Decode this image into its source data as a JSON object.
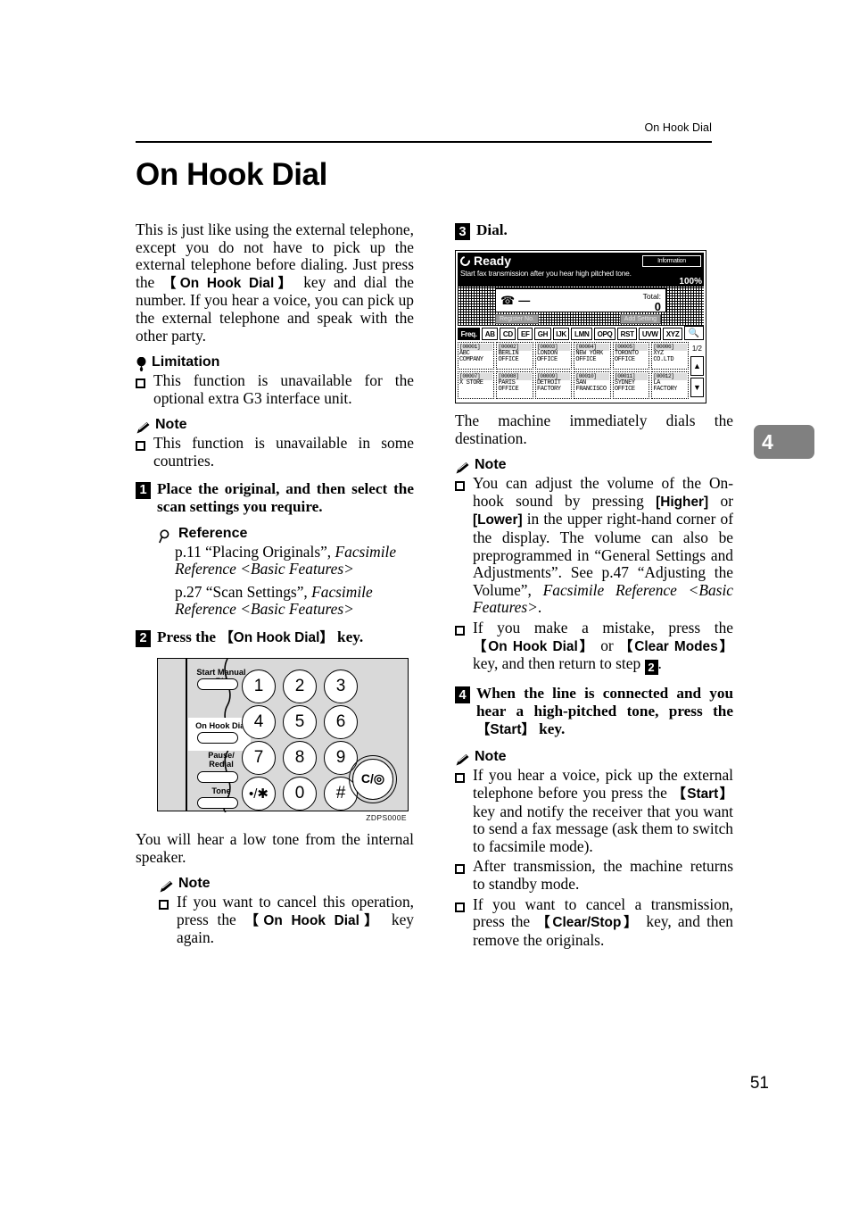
{
  "header": {
    "running_head": "On Hook Dial"
  },
  "chapter_tab": {
    "number": "4"
  },
  "title": "On Hook Dial",
  "page_number": "51",
  "left_column": {
    "intro_a": "This is just like using the external telephone, except you do not have to pick up the external telephone before dialing. Just press the ",
    "intro_key1": "【On Hook Dial】",
    "intro_b": " key and dial the number. If you hear a voice, you can pick up the external telephone and speak with the other party.",
    "limitation_heading": "Limitation",
    "limitation_item": "This function is unavailable for the optional extra G3 interface unit.",
    "note1_heading": "Note",
    "note1_item": "This function is unavailable in some countries.",
    "step1_number": "1",
    "step1_text": "Place the original, and then select the scan settings you require.",
    "reference_heading": "Reference",
    "reference_1_a": "p.11 “Placing Originals”, ",
    "reference_1_b": "Facsimile Reference <Basic Features>",
    "reference_2_a": "p.27 “Scan Settings”, ",
    "reference_2_b": "Facsimile Reference <Basic Features>",
    "step2_number": "2",
    "step2_a": "Press the ",
    "step2_key": "【On Hook Dial】",
    "step2_b": " key.",
    "result2": "You will hear a low tone from the internal speaker.",
    "note2_heading": "Note",
    "note2_a": "If you want to cancel this operation, press the ",
    "note2_key": "【On Hook Dial】",
    "note2_b": " key again."
  },
  "keypad_figure": {
    "figure_code": "ZDPS000E",
    "function_keys": [
      {
        "label": "Start Manual RX",
        "highlighted": false
      },
      {
        "label": "On Hook Dial",
        "highlighted": true
      },
      {
        "label": "Pause/\nRedial",
        "highlighted": false
      },
      {
        "label": "Tone",
        "highlighted": false
      }
    ],
    "number_keys": [
      "1",
      "2",
      "3",
      "4",
      "5",
      "6",
      "7",
      "8",
      "9",
      "•/✳",
      "0",
      "#"
    ],
    "clear_key": "C/◎"
  },
  "right_column": {
    "step3_number": "3",
    "step3_text": "Dial.",
    "result3": "The machine immediately dials the destination.",
    "note3_heading": "Note",
    "note3_1_a": "You can adjust the volume of the On-hook sound by pressing ",
    "note3_1_k1": "[Higher]",
    "note3_1_b": " or ",
    "note3_1_k2": "[Lower]",
    "note3_1_c": " in the upper right-hand corner of the display. The volume can also be preprogrammed in “General Settings and Adjustments”. See p.47 “Adjusting the Volume”, ",
    "note3_1_i": "Facsimile Reference <Basic Features>",
    "note3_1_d": ".",
    "note3_2_a": "If you make a mistake, press the ",
    "note3_2_k1": "【On Hook Dial】",
    "note3_2_b": " or ",
    "note3_2_k2": "【Clear Modes】",
    "note3_2_c": " key, and then return to step ",
    "note3_2_step": "2",
    "note3_2_d": ".",
    "step4_number": "4",
    "step4_a": "When the line is connected and you hear a high-pitched tone, press the ",
    "step4_key": "【Start】",
    "step4_b": " key.",
    "note4_heading": "Note",
    "note4_1_a": "If you hear a voice, pick up the external telephone before you press the ",
    "note4_1_key": "【Start】",
    "note4_1_b": " key and notify the receiver that you want to send a fax message (ask them to switch to facsimile mode).",
    "note4_2": "After transmission, the machine returns to standby mode.",
    "note4_3_a": "If you want to cancel a transmission, press the ",
    "note4_3_key": "【Clear/Stop】",
    "note4_3_b": " key, and then remove the originals."
  },
  "lcd_figure": {
    "status": "Ready",
    "subtitle": "Start fax transmission after you hear high pitched tone.",
    "info_button": "Information",
    "zoom_percent": "100%",
    "total_label": "Total:",
    "total_value": "0",
    "soft_buttons": [
      "Register No.",
      "Add Setting"
    ],
    "page_indicator": "1/2",
    "tabs": [
      "Freq.",
      "AB",
      "CD",
      "EF",
      "GH",
      "IJK",
      "LMN",
      "OPQ",
      "RST",
      "UVW",
      "XYZ"
    ],
    "active_tab": "Freq.",
    "search_icon": "search-icon",
    "scroll_up_icon": "scroll-up-icon",
    "scroll_down_icon": "scroll-down-icon",
    "destinations": [
      {
        "id": "[00001]",
        "name": "ABC COMPANY"
      },
      {
        "id": "[00002]",
        "name": "BERLIN OFFICE"
      },
      {
        "id": "[00003]",
        "name": "LONDON OFFICE"
      },
      {
        "id": "[00004]",
        "name": "NEW YORK OFFICE"
      },
      {
        "id": "[00005]",
        "name": "TORONTO OFFICE"
      },
      {
        "id": "[00006]",
        "name": "XYZ CO.LTD"
      },
      {
        "id": "[00007]",
        "name": "X STORE"
      },
      {
        "id": "[00008]",
        "name": "PARIS OFFICE"
      },
      {
        "id": "[00009]",
        "name": "DETROIT FACTORY"
      },
      {
        "id": "[00010]",
        "name": "SAN FRANCISCO"
      },
      {
        "id": "[00011]",
        "name": "SYDNEY OFFICE"
      },
      {
        "id": "[00012]",
        "name": "LA FACTORY"
      }
    ]
  }
}
